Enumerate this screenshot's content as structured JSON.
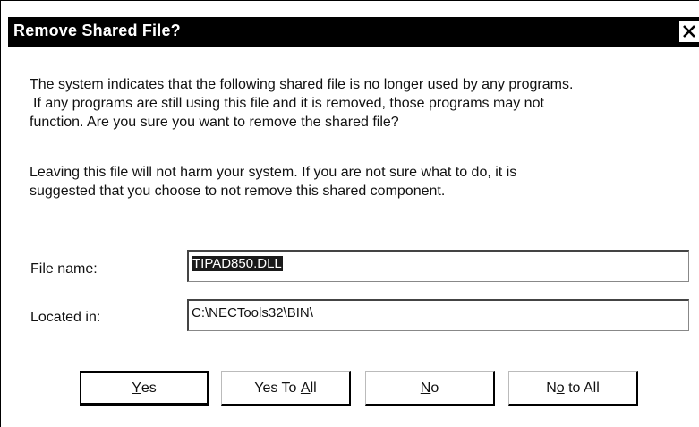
{
  "dialog": {
    "title": "Remove Shared File?",
    "close_glyph": "✕",
    "message_line1": "The system indicates that the following shared file is no longer used by any programs.",
    "message_line2": "If any programs are still using this file and it is removed, those programs may not",
    "message_line3": "function.  Are you sure you want to remove the shared file?",
    "advice_line1": "Leaving this file will not harm your system.  If you are not sure what to do, it is",
    "advice_line2": "suggested that you choose to not remove this shared component.",
    "file_name_label": "File name:",
    "file_name_value": "TIPAD850.DLL",
    "located_in_label": "Located in:",
    "located_in_value": "C:\\NECTools32\\BIN\\",
    "buttons": {
      "yes": {
        "mnemonic": "Y",
        "rest": "es"
      },
      "yes_to_all": {
        "before": "Yes To ",
        "mnemonic": "A",
        "rest": "ll"
      },
      "no": {
        "mnemonic": "N",
        "rest": "o"
      },
      "no_to_all": {
        "before": "N",
        "mnemonic": "o",
        "rest": " to All"
      }
    }
  }
}
